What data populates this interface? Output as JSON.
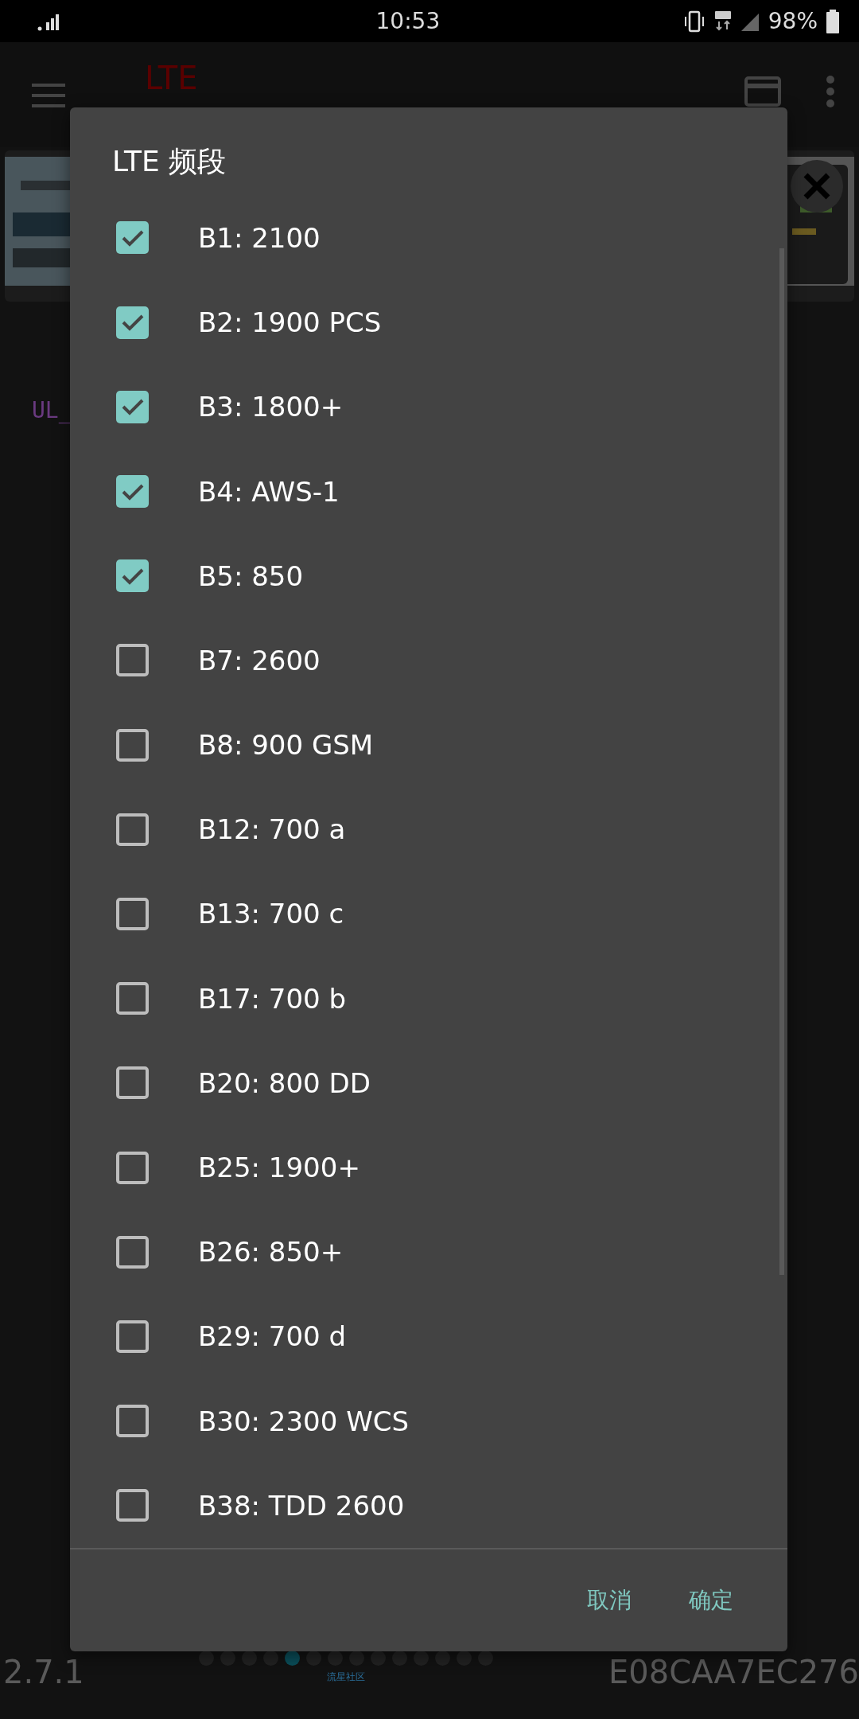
{
  "status_bar": {
    "time": "10:53",
    "battery": "98%"
  },
  "app_bar": {
    "title": "LTE"
  },
  "background": {
    "text": "UL_"
  },
  "dialog": {
    "title": "LTE 频段",
    "bands": [
      {
        "label": "B1: 2100",
        "checked": true
      },
      {
        "label": "B2: 1900 PCS",
        "checked": true
      },
      {
        "label": "B3: 1800+",
        "checked": true
      },
      {
        "label": "B4: AWS-1",
        "checked": true
      },
      {
        "label": "B5: 850",
        "checked": true
      },
      {
        "label": "B7: 2600",
        "checked": false
      },
      {
        "label": "B8: 900 GSM",
        "checked": false
      },
      {
        "label": "B12: 700 a",
        "checked": false
      },
      {
        "label": "B13: 700 c",
        "checked": false
      },
      {
        "label": "B17: 700 b",
        "checked": false
      },
      {
        "label": "B20: 800 DD",
        "checked": false
      },
      {
        "label": "B25: 1900+",
        "checked": false
      },
      {
        "label": "B26: 850+",
        "checked": false
      },
      {
        "label": "B29: 700 d",
        "checked": false
      },
      {
        "label": "B30: 2300 WCS",
        "checked": false
      },
      {
        "label": "B38: TDD 2600",
        "checked": false
      }
    ],
    "buttons": [
      "取消",
      "确定"
    ]
  },
  "footer": {
    "version": "2.7.1",
    "id": "E08CAA7EC276",
    "caption": "流星社区",
    "dots": [
      {
        "selected": false
      },
      {
        "selected": false
      },
      {
        "selected": false
      },
      {
        "selected": false
      },
      {
        "selected": true
      },
      {
        "selected": false
      },
      {
        "selected": false
      },
      {
        "selected": false
      },
      {
        "selected": false
      },
      {
        "selected": false
      },
      {
        "selected": false
      },
      {
        "selected": false
      },
      {
        "selected": false
      },
      {
        "selected": false
      }
    ]
  }
}
